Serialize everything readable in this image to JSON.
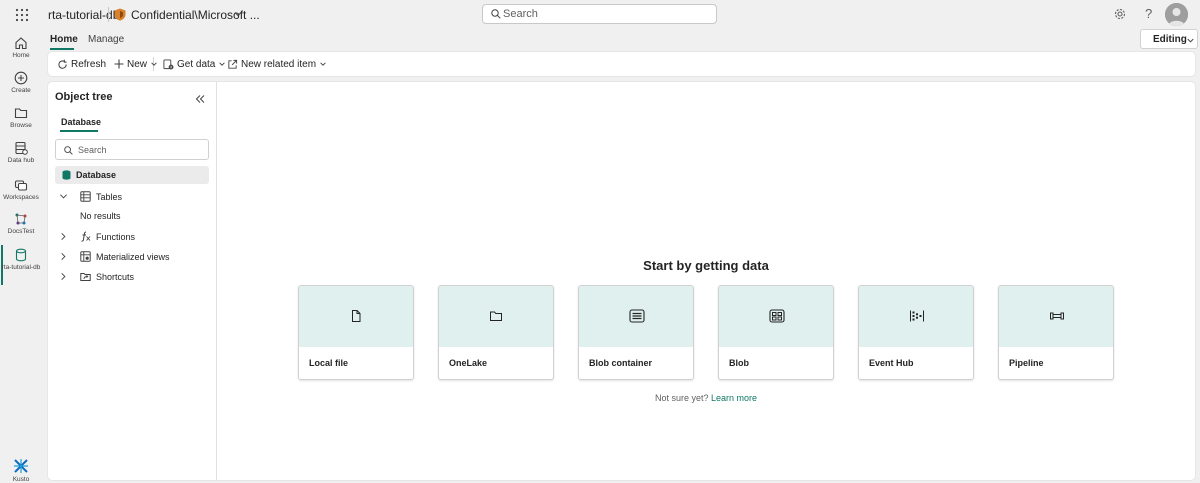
{
  "topbar": {
    "title": "rta-tutorial-db",
    "sensitivity_label": "Confidential\\Microsoft ...",
    "search_placeholder": "Search",
    "help_label": "?"
  },
  "nav": {
    "items": [
      {
        "label": "Home",
        "icon": "home-icon"
      },
      {
        "label": "Create",
        "icon": "plus-circle-icon"
      },
      {
        "label": "Browse",
        "icon": "folder-icon"
      },
      {
        "label": "Data hub",
        "icon": "data-hub-icon"
      },
      {
        "label": "Workspaces",
        "icon": "workspaces-icon"
      },
      {
        "label": "DocsTest",
        "icon": "workspace-icon"
      },
      {
        "label": "rta-tutorial-db",
        "icon": "database-icon"
      }
    ],
    "active_index": 6,
    "bottom_label": "Kusto"
  },
  "ribbon": {
    "tabs": [
      "Home",
      "Manage"
    ],
    "active_tab": "Home",
    "mode": "Editing",
    "toolbar": {
      "refresh": "Refresh",
      "new": "New",
      "get_data": "Get data",
      "new_related": "New related item"
    }
  },
  "object_tree": {
    "title": "Object tree",
    "tab": "Database",
    "search_placeholder": "Search",
    "root": "Database",
    "nodes": [
      {
        "label": "Tables",
        "expanded": true
      },
      {
        "label": "Functions",
        "expanded": false
      },
      {
        "label": "Materialized views",
        "expanded": false
      },
      {
        "label": "Shortcuts",
        "expanded": false
      }
    ],
    "empty_text": "No results"
  },
  "get_data": {
    "heading": "Start by getting data",
    "sources": [
      {
        "label": "Local file",
        "icon": "file-icon"
      },
      {
        "label": "OneLake",
        "icon": "folder-icon"
      },
      {
        "label": "Blob container",
        "icon": "blob-container-icon"
      },
      {
        "label": "Blob",
        "icon": "blob-icon"
      },
      {
        "label": "Event Hub",
        "icon": "event-hub-icon"
      },
      {
        "label": "Pipeline",
        "icon": "pipeline-icon"
      }
    ],
    "footer_text": "Not sure yet?",
    "footer_link": "Learn more"
  },
  "colors": {
    "accent": "#117865",
    "card_header": "#dff0ee",
    "background": "#f0f0f0"
  }
}
